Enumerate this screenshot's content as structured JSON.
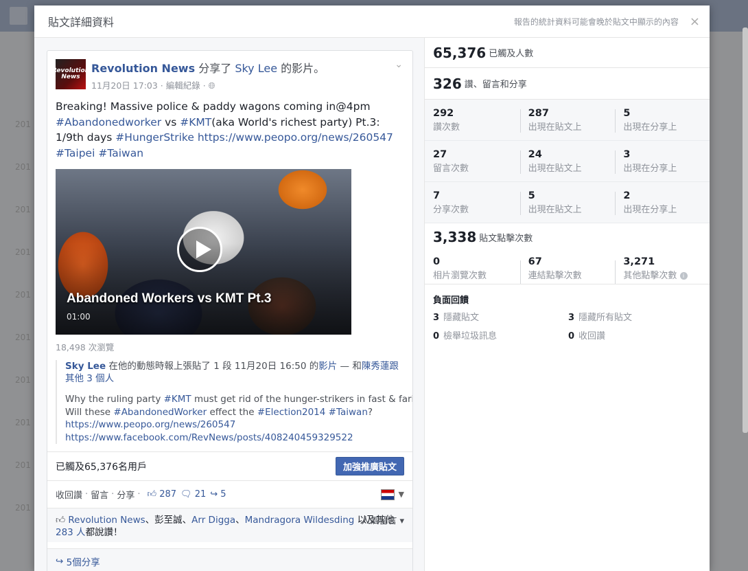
{
  "dialog": {
    "title": "貼文詳細資料",
    "note": "報告的統計資料可能會晚於貼文中顯示的內容",
    "close": "×"
  },
  "background": {
    "years": [
      "201",
      "201",
      "201",
      "201",
      "201",
      "201",
      "201",
      "201",
      "201",
      "201",
      "201"
    ]
  },
  "post": {
    "avatar_text": "Revolution News",
    "author": "Revolution News",
    "shared_verb": "分享了",
    "shared_owner": "Sky Lee",
    "shared_suffix": "的影片。",
    "date": "11月20日 17:03 · 編輯紀錄 · ",
    "globe_icon": "globe-icon",
    "text": {
      "part1": "Breaking! Massive police & paddy wagons coming in@4pm ",
      "tag_abandoned": "#Abandonedworker",
      "part2": " vs ",
      "tag_kmt": "#KMT",
      "part3": "(aka World's richest party) Pt.3: 1/9th days ",
      "tag_hunger": "#HungerStrike",
      "part4": " ",
      "url": "https://www.peopo.org/news/260547",
      "part5": " ",
      "tag_taipei": "#Taipei",
      "part6": " ",
      "tag_taiwan": "#Taiwan"
    },
    "video": {
      "title": "Abandoned Workers vs KMT Pt.3",
      "duration": "01:00"
    },
    "views": "18,498 次瀏覽",
    "shared_post": {
      "author": "Sky Lee",
      "action": " 在他的動態時報上張貼了 1 段 11月20日 16:50 的",
      "video_link": "影片",
      "with": " — 和",
      "with_link": "陳秀蓮跟其他 3 個人",
      "msg_line1_a": "Why the ruling party ",
      "msg_tag_kmt": "#KMT",
      "msg_line1_b": " must get rid of the hunger-strikers in fast & farious?",
      "msg_line2_a": "Will these ",
      "msg_tag_aw": "#AbandonedWorker",
      "msg_line2_b": " effect the ",
      "msg_tag_election": "#Election2014",
      "msg_line2_c": " ",
      "msg_tag_taiwan": "#Taiwan",
      "msg_line2_d": "?",
      "url1": "https://www.peopo.org/news/260547",
      "url2": "https://www.facebook.com/RevNews/posts/408240459329522"
    },
    "reach_text": "已觸及65,376名用戶",
    "boost_label": "加強推廣貼文",
    "actions": {
      "like": "收回讚",
      "comment": "留言",
      "share": "分享",
      "like_count": "287",
      "comment_count": "21",
      "share_count": "5"
    },
    "likes": {
      "names1": "Revolution News",
      "names2": "、彭至誠、",
      "names3": "Arr Digga",
      "names4": "、",
      "names5": "Mandragora Wildesding",
      "names6": " 以及其他 ",
      "others": "283 人",
      "suffix": "都說讚！",
      "popular": "人氣留言"
    },
    "shares_text": "5個分享"
  },
  "insights": {
    "reach_value": "65,376",
    "reach_label": "已觸及人數",
    "engagement_value": "326",
    "engagement_label": "讚、留言和分享",
    "grid": [
      [
        {
          "num": "292",
          "label": "讚次數"
        },
        {
          "num": "287",
          "label": "出現在貼文上"
        },
        {
          "num": "5",
          "label": "出現在分享上"
        }
      ],
      [
        {
          "num": "27",
          "label": "留言次數"
        },
        {
          "num": "24",
          "label": "出現在貼文上"
        },
        {
          "num": "3",
          "label": "出現在分享上"
        }
      ],
      [
        {
          "num": "7",
          "label": "分享次數"
        },
        {
          "num": "5",
          "label": "出現在貼文上"
        },
        {
          "num": "2",
          "label": "出現在分享上"
        }
      ]
    ],
    "clicks_value": "3,338",
    "clicks_label": "貼文點擊次數",
    "clicks": [
      {
        "num": "0",
        "label": "相片瀏覽次數"
      },
      {
        "num": "67",
        "label": "連結點擊次數"
      },
      {
        "num": "3,271",
        "label": "其他點擊次數"
      }
    ],
    "negative_title": "負面回饋",
    "negative": [
      {
        "num": "3",
        "label": "隱藏貼文"
      },
      {
        "num": "3",
        "label": "隱藏所有貼文"
      },
      {
        "num": "0",
        "label": "檢舉垃圾訊息"
      },
      {
        "num": "0",
        "label": "收回讚"
      }
    ]
  }
}
